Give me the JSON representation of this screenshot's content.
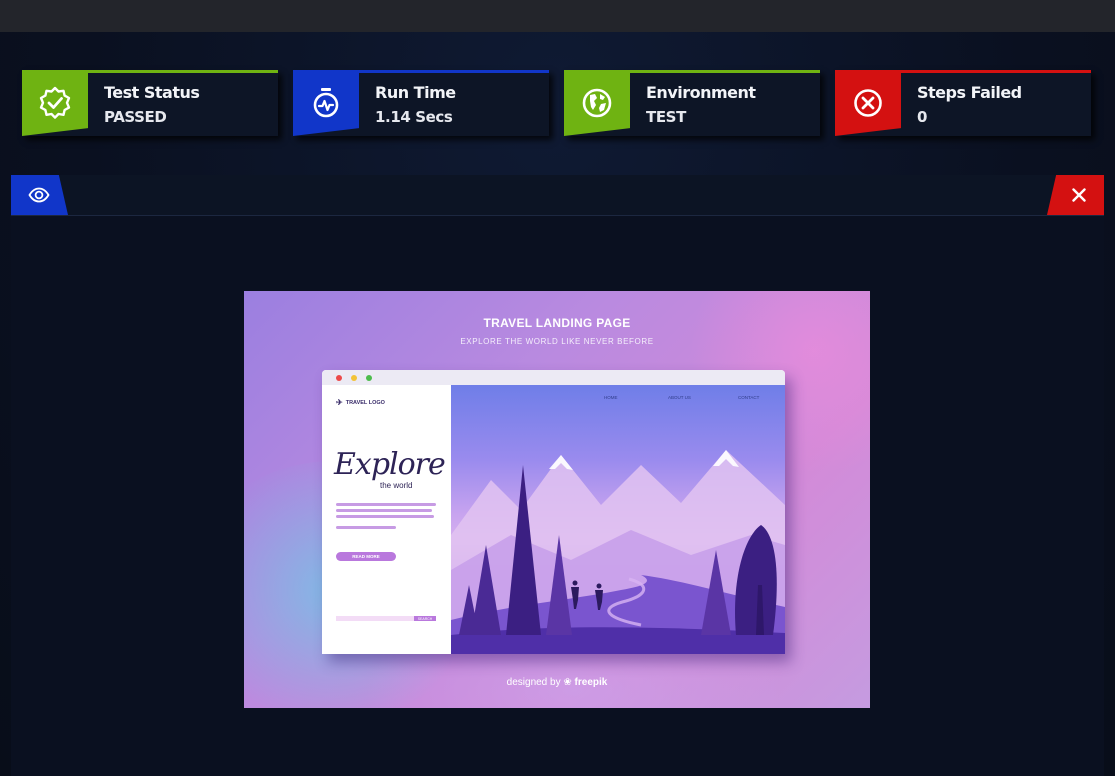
{
  "cards": [
    {
      "label": "Test Status",
      "value": "PASSED",
      "icon": "badge-check-icon",
      "color": "#6fb312"
    },
    {
      "label": "Run Time",
      "value": "1.14 Secs",
      "icon": "stopwatch-icon",
      "color": "#1136c9"
    },
    {
      "label": "Environment",
      "value": "TEST",
      "icon": "globe-icon",
      "color": "#6fb312"
    },
    {
      "label": "Steps Failed",
      "value": "0",
      "icon": "x-circle-icon",
      "color": "#d41111"
    }
  ],
  "viewer": {
    "view_icon": "eye-icon",
    "close_icon": "close-icon"
  },
  "screenshot": {
    "title": "TRAVEL LANDING PAGE",
    "subtitle": "EXPLORE THE WORLD LIKE NEVER BEFORE",
    "logo": "TRAVEL LOGO",
    "nav": [
      "HOME",
      "ABOUT US",
      "CONTACT"
    ],
    "headline": "Explore",
    "headline_sub": "the world",
    "button": "READ MORE",
    "search_button": "SEARCH",
    "credit_prefix": "designed by",
    "credit_brand": "freepik"
  }
}
